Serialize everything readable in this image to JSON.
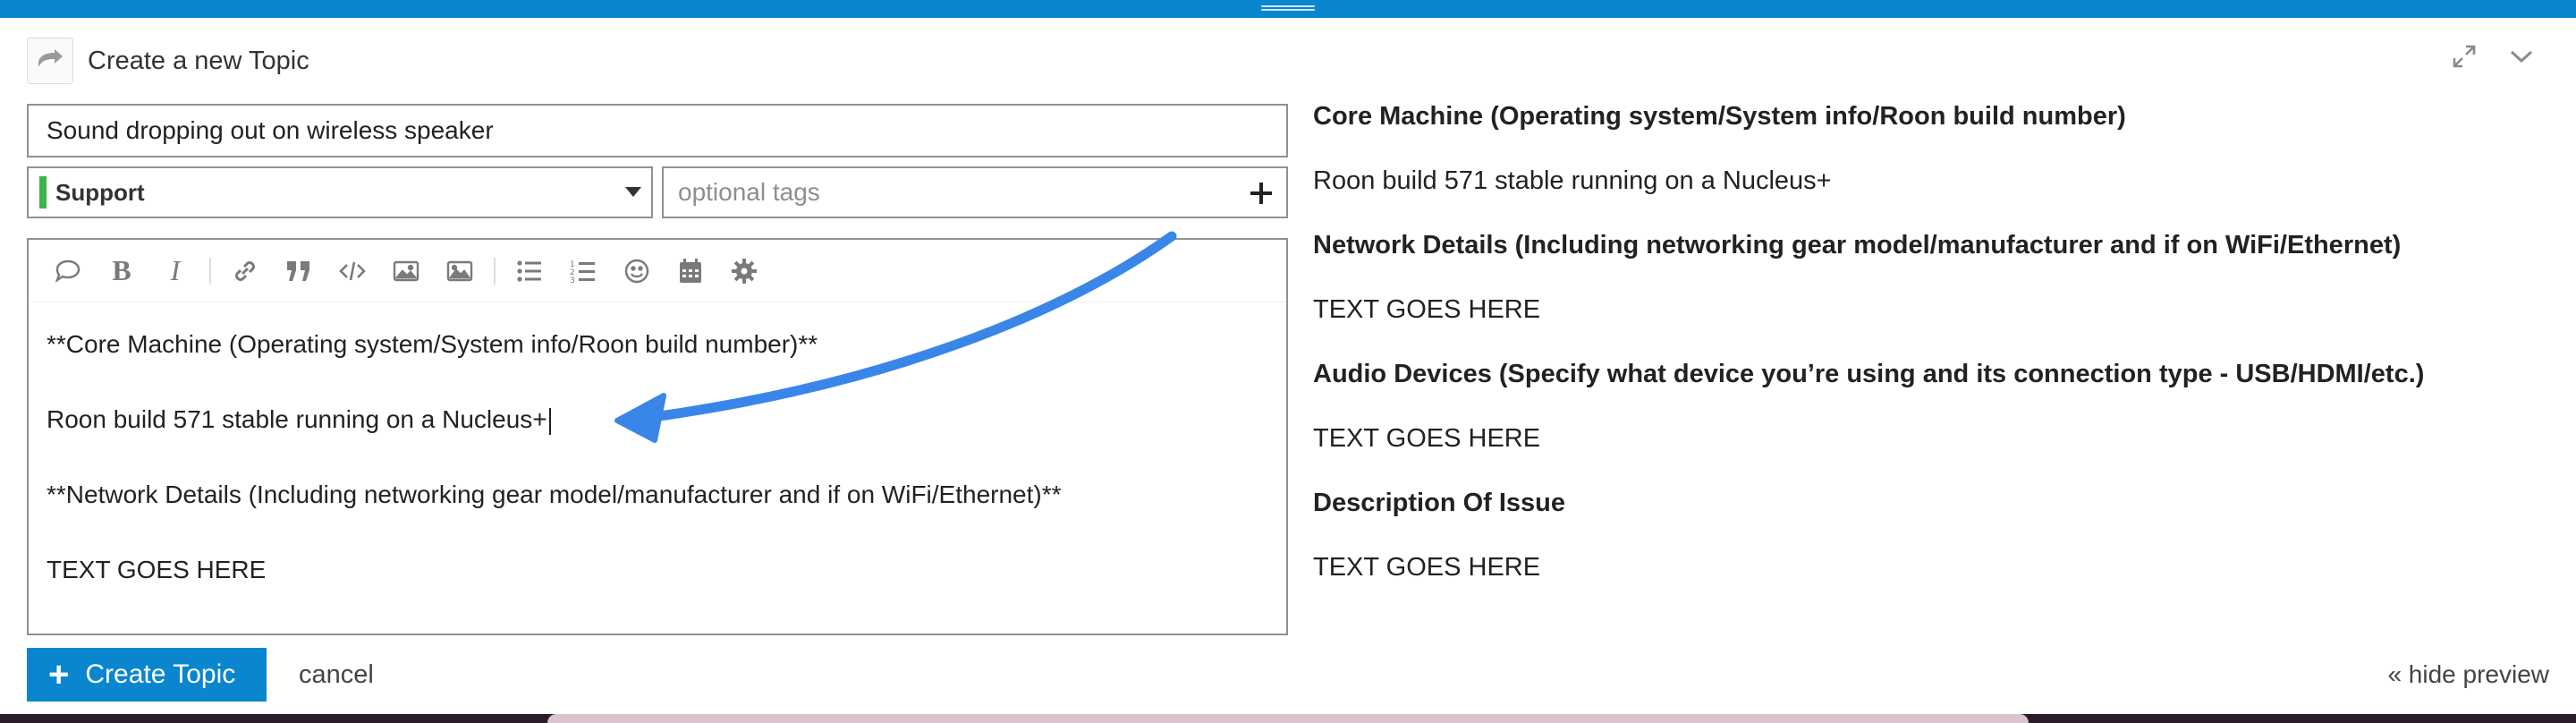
{
  "header": {
    "title": "Create a new Topic",
    "reply_icon": "reply-arrow-icon",
    "expand_icon": "expand-icon",
    "collapse_icon": "chevron-down-icon"
  },
  "composer": {
    "title_value": "Sound dropping out on wireless speaker",
    "category": {
      "label": "Support",
      "color": "#3ab54a"
    },
    "tags_placeholder": "optional tags",
    "toolbar": [
      "quote-post-icon",
      "bold-icon",
      "italic-icon",
      "link-icon",
      "blockquote-icon",
      "preformatted-code-icon",
      "upload-image-icon",
      "image-icon",
      "bullet-list-icon",
      "numbered-list-icon",
      "emoji-icon",
      "calendar-icon",
      "gear-icon"
    ],
    "body_lines": [
      "**Core Machine (Operating system/System info/Roon build number)**",
      "Roon build 571 stable running on a Nucleus+",
      "**Network Details (Including networking gear model/manufacturer and if on WiFi/Ethernet)**",
      "TEXT GOES HERE"
    ]
  },
  "preview": {
    "lines": [
      {
        "text": "Core Machine (Operating system/System info/Roon build number)",
        "bold": true
      },
      {
        "text": "Roon build 571 stable running on a Nucleus+",
        "bold": false
      },
      {
        "text": "Network Details (Including networking gear model/manufacturer and if on WiFi/Ethernet)",
        "bold": true
      },
      {
        "text": "TEXT GOES HERE",
        "bold": false
      },
      {
        "text": "Audio Devices (Specify what device you’re using and its connection type - USB/HDMI/etc.)",
        "bold": true
      },
      {
        "text": "TEXT GOES HERE",
        "bold": false
      },
      {
        "text": "Description Of Issue",
        "bold": true
      },
      {
        "text": "TEXT GOES HERE",
        "bold": false
      }
    ]
  },
  "footer": {
    "create_label": "Create Topic",
    "cancel_label": "cancel",
    "hide_preview_label": "« hide preview"
  },
  "annotation": {
    "arrow_color": "#3a86e8"
  },
  "colors": {
    "accent": "#0a86cf"
  }
}
